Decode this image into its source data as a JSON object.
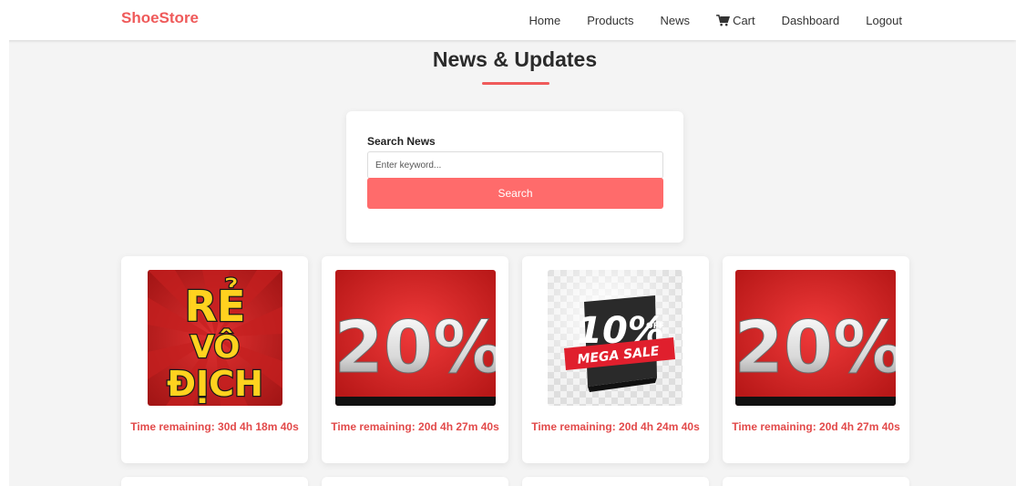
{
  "brand": {
    "name": "ShoeStore",
    "color": "#ef5a5a"
  },
  "nav": {
    "home": "Home",
    "products": "Products",
    "news": "News",
    "cart": "Cart",
    "dashboard": "Dashboard",
    "logout": "Logout"
  },
  "page": {
    "title": "News & Updates",
    "accent": "#ef5a5a"
  },
  "search": {
    "label": "Search News",
    "placeholder": "Enter keyword...",
    "button": "Search",
    "button_color": "#ff6b6b"
  },
  "news": [
    {
      "image_icon": "re-vo-dich-promo-image",
      "image_lines": [
        "RẺ",
        "VÔ",
        "ĐỊCH"
      ],
      "timer": "Time remaining: 30d 4h 18m 40s"
    },
    {
      "image_icon": "twenty-percent-sale-image",
      "image_text": "20%",
      "timer": "Time remaining: 20d 4h 27m 40s"
    },
    {
      "image_icon": "mega-sale-badge-image",
      "image_text": "10%",
      "image_sub": "OFF",
      "image_ribbon": "MEGA SALE",
      "timer": "Time remaining: 20d 4h 24m 40s"
    },
    {
      "image_icon": "twenty-percent-sale-image",
      "image_text": "20%",
      "timer": "Time remaining: 20d 4h 27m 40s"
    }
  ],
  "colors": {
    "timer": "#e24a4a",
    "background": "#f4f4f4"
  }
}
